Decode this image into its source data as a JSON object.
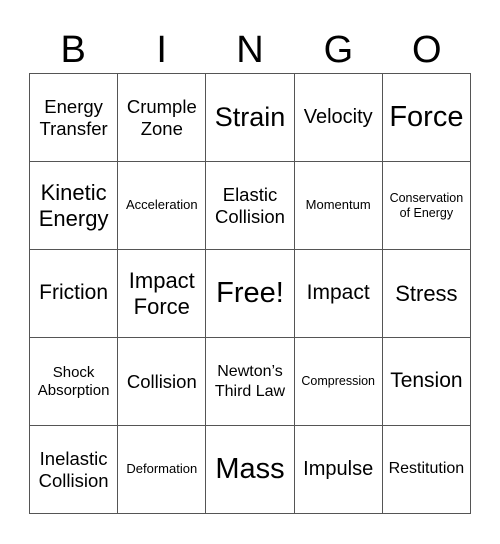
{
  "header": [
    "B",
    "I",
    "N",
    "G",
    "O"
  ],
  "cells": [
    [
      "Energy Transfer",
      "Crumple Zone",
      "Strain",
      "Velocity",
      "Force"
    ],
    [
      "Kinetic Energy",
      "Acceleration",
      "Elastic Collision",
      "Momentum",
      "Conservation of Energy"
    ],
    [
      "Friction",
      "Impact Force",
      "Free!",
      "Impact",
      "Stress"
    ],
    [
      "Shock Absorption",
      "Collision",
      "Newton’s Third Law",
      "Compression",
      "Tension"
    ],
    [
      "Inelastic Collision",
      "Deformation",
      "Mass",
      "Impulse",
      "Restitution"
    ]
  ]
}
